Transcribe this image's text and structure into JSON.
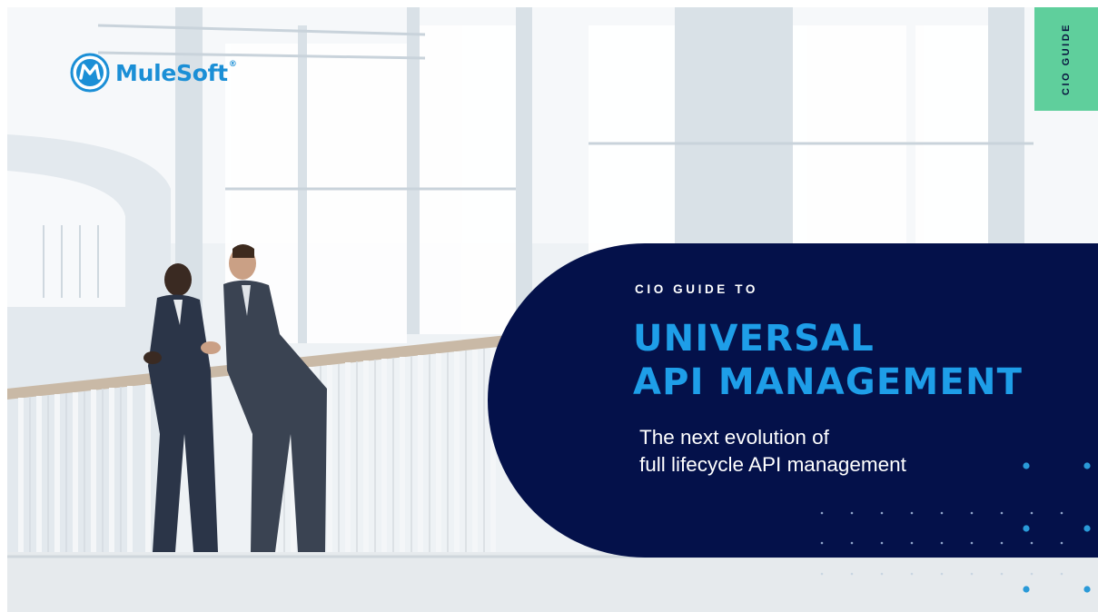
{
  "logo": {
    "brand": "MuleSoft",
    "registered": "®"
  },
  "tab": {
    "label": "CIO GUIDE"
  },
  "panel": {
    "eyebrow": "CIO GUIDE TO",
    "headline_line1": "UNIVERSAL",
    "headline_line2": "API MANAGEMENT",
    "subhead_line1": "The next evolution of",
    "subhead_line2": "full lifecycle API management"
  },
  "colors": {
    "panel_navy": "#04114a",
    "headline_blue": "#1e9ee8",
    "tab_green": "#5fcf9c",
    "brand_blue": "#1b8fd6",
    "dot_blue": "#2a9ad8"
  },
  "icons": [
    "mulesoft-logo-icon"
  ]
}
